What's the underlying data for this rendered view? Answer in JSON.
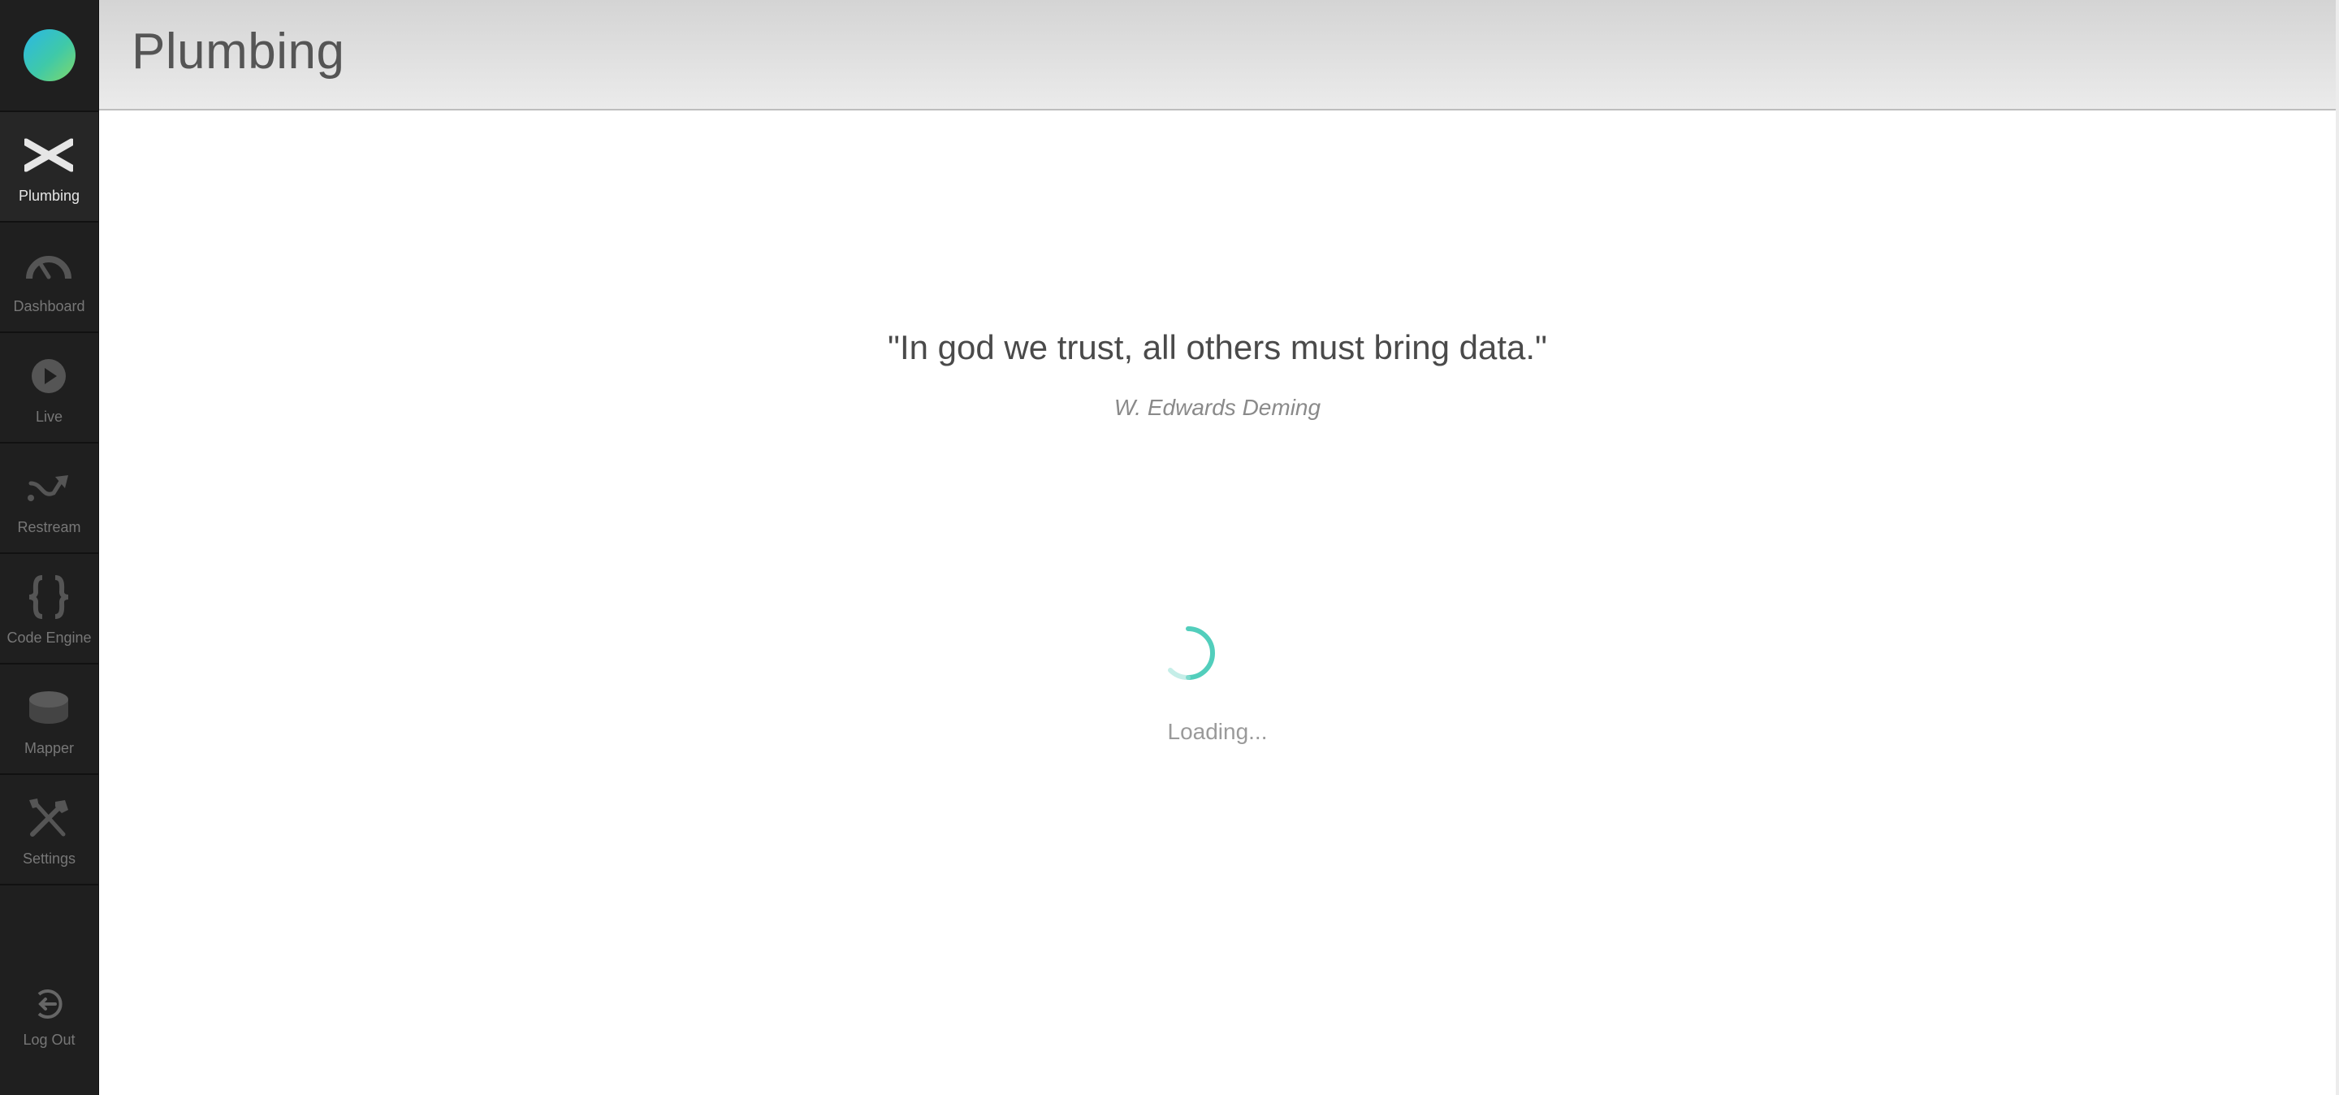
{
  "sidebar": {
    "items": [
      {
        "label": "Plumbing",
        "icon": "plumbing-icon",
        "active": true
      },
      {
        "label": "Dashboard",
        "icon": "gauge-icon"
      },
      {
        "label": "Live",
        "icon": "play-icon"
      },
      {
        "label": "Restream",
        "icon": "restream-icon"
      },
      {
        "label": "Code Engine",
        "icon": "braces-icon"
      },
      {
        "label": "Mapper",
        "icon": "database-icon"
      },
      {
        "label": "Settings",
        "icon": "tools-icon"
      }
    ],
    "logout_label": "Log Out"
  },
  "header": {
    "title": "Plumbing"
  },
  "main": {
    "quote": "\"In god we trust, all others must bring data.\"",
    "author": "W. Edwards Deming",
    "loading": "Loading..."
  },
  "colors": {
    "sidebar_bg": "#1f1f1f",
    "accent": "#3fc9b5",
    "logo_gradient": [
      "#2ab7e6",
      "#7fd86a"
    ]
  }
}
